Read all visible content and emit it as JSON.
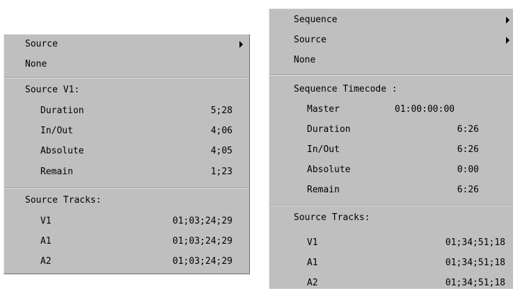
{
  "left_menu": {
    "items": [
      {
        "label": "Source"
      },
      {
        "label": "None"
      }
    ],
    "section1_header": "Source V1:",
    "section1_rows": [
      {
        "label": "Duration",
        "value": "5;28"
      },
      {
        "label": "In/Out",
        "value": "4;06"
      },
      {
        "label": "Absolute",
        "value": "4;05"
      },
      {
        "label": "Remain",
        "value": "1;23"
      }
    ],
    "section2_header": "Source Tracks:",
    "section2_rows": [
      {
        "label": "V1",
        "value": "01;03;24;29"
      },
      {
        "label": "A1",
        "value": "01;03;24;29"
      },
      {
        "label": "A2",
        "value": "01;03;24;29"
      }
    ]
  },
  "right_menu": {
    "items": [
      {
        "label": "Sequence"
      },
      {
        "label": "Source"
      },
      {
        "label": "None"
      }
    ],
    "section1_header": "Sequence Timecode :",
    "section1_rows": [
      {
        "label": "Master",
        "value": "01:00:00:00"
      },
      {
        "label": "Duration",
        "value": "6:26"
      },
      {
        "label": "In/Out",
        "value": "6:26"
      },
      {
        "label": "Absolute",
        "value": "0:00"
      },
      {
        "label": "Remain",
        "value": "6:26"
      }
    ],
    "section2_header": "Source Tracks:",
    "section2_rows": [
      {
        "label": "V1",
        "value": "01;34;51;18"
      },
      {
        "label": "A1",
        "value": "01;34;51;18"
      },
      {
        "label": "A2",
        "value": "01;34;51;18"
      }
    ]
  }
}
